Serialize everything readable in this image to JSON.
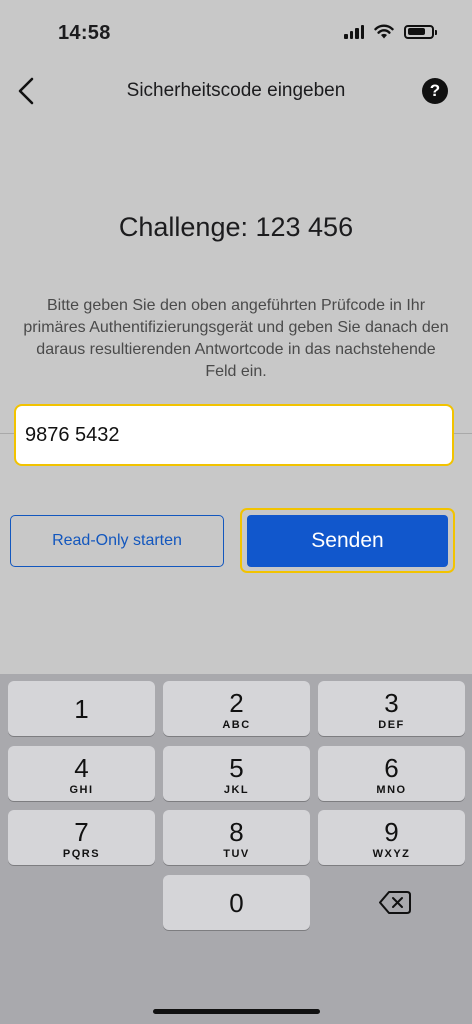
{
  "status": {
    "time": "14:58"
  },
  "nav": {
    "title": "Sicherheitscode eingeben",
    "help": "?"
  },
  "challenge": "Challenge: 123 456",
  "instructions": "Bitte geben Sie den oben angeführten Prüfcode in Ihr primäres Authentifizierungsgerät und geben Sie danach den daraus resultierenden Antwortcode in das nachstehende Feld ein.",
  "response_field": {
    "value": "9876 5432"
  },
  "buttons": {
    "read_only": "Read-Only starten",
    "send": "Senden"
  },
  "colors": {
    "accent": "#1157cc",
    "focus_ring": "#f2c300"
  },
  "keypad": {
    "keys": [
      {
        "digit": "1",
        "letters": ""
      },
      {
        "digit": "2",
        "letters": "ABC"
      },
      {
        "digit": "3",
        "letters": "DEF"
      },
      {
        "digit": "4",
        "letters": "GHI"
      },
      {
        "digit": "5",
        "letters": "JKL"
      },
      {
        "digit": "6",
        "letters": "MNO"
      },
      {
        "digit": "7",
        "letters": "PQRS"
      },
      {
        "digit": "8",
        "letters": "TUV"
      },
      {
        "digit": "9",
        "letters": "WXYZ"
      },
      {
        "digit": "0",
        "letters": ""
      }
    ],
    "backspace_icon": "backspace-icon"
  }
}
